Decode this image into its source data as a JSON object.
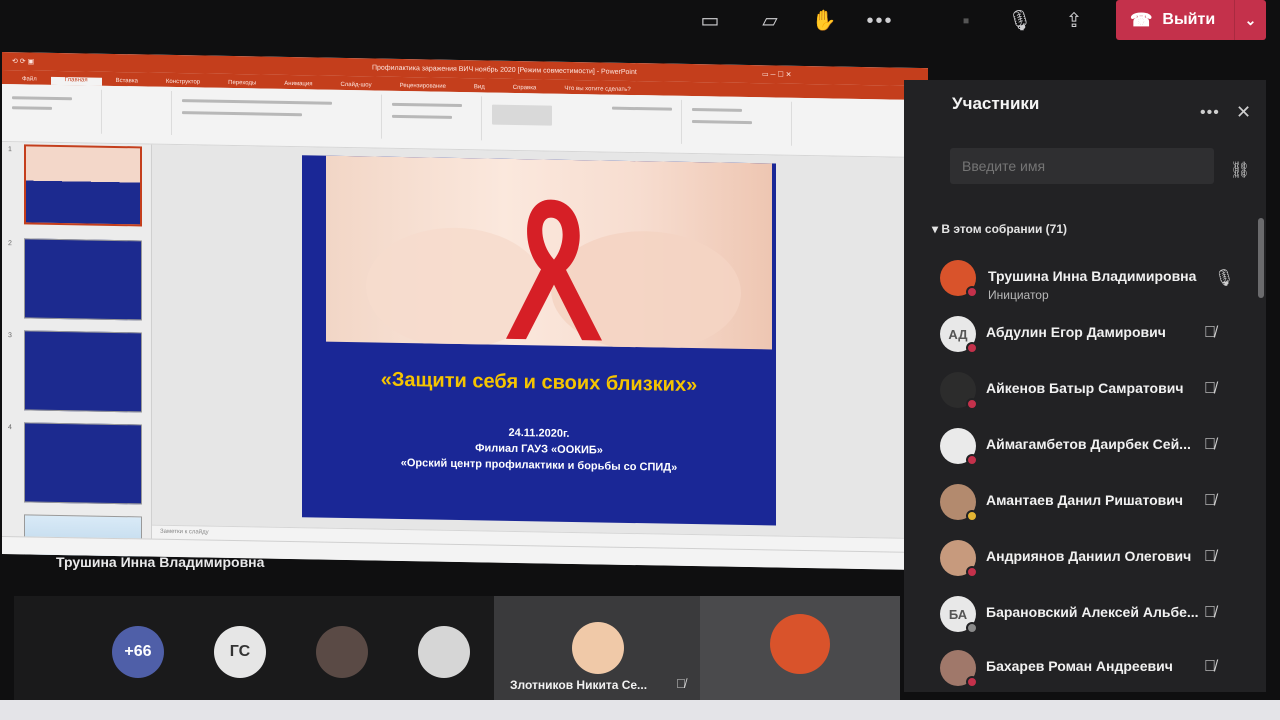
{
  "top_bar": {
    "leave_label": "Выйти",
    "icons": [
      "share-tray-icon",
      "chat-icon",
      "raise-hand-icon",
      "more-icon",
      "camera-off-icon",
      "mic-icon",
      "share-screen-icon"
    ]
  },
  "ppt": {
    "title": "Профилактика заражения ВИЧ ноябрь 2020 [Режим совместимости] - PowerPoint",
    "tabs": [
      "Файл",
      "Главная",
      "Вставка",
      "Конструктор",
      "Переходы",
      "Анимация",
      "Слайд-шоу",
      "Рецензирование",
      "Вид",
      "Справка",
      "Что вы хотите сделать?"
    ],
    "notes_placeholder": "Заметки к слайду",
    "slide": {
      "title": "«Защити себя и своих близких»",
      "date": "24.11.2020г.",
      "org": "Филиал ГАУЗ «ООКИБ»",
      "center": "«Орский центр профилактики и борьбы со СПИД»"
    }
  },
  "presenter_name": "Трушина Инна Владимировна",
  "tiles": {
    "overflow_count": "+66",
    "initials": "ГС",
    "zlotnikov_name": "Злотников Никита Се..."
  },
  "participants": {
    "title": "Участники",
    "search_placeholder": "Введите имя",
    "section": "В этом собрании (71)",
    "people": [
      {
        "name": "Трушина Инна Владимировна",
        "role": "Инициатор",
        "initials": ""
      },
      {
        "name": "Абдулин Егор Дамирович",
        "role": "",
        "initials": "АД"
      },
      {
        "name": "Айкенов Батыр Самратович",
        "role": "",
        "initials": ""
      },
      {
        "name": "Аймагамбетов Даирбек Сей...",
        "role": "",
        "initials": ""
      },
      {
        "name": "Амантаев Данил Ришатович",
        "role": "",
        "initials": ""
      },
      {
        "name": "Андриянов Даниил Олегович",
        "role": "",
        "initials": ""
      },
      {
        "name": "Барановский Алексей Альбе...",
        "role": "",
        "initials": "БА"
      },
      {
        "name": "Бахарев Роман Андреевич",
        "role": "",
        "initials": ""
      }
    ]
  }
}
